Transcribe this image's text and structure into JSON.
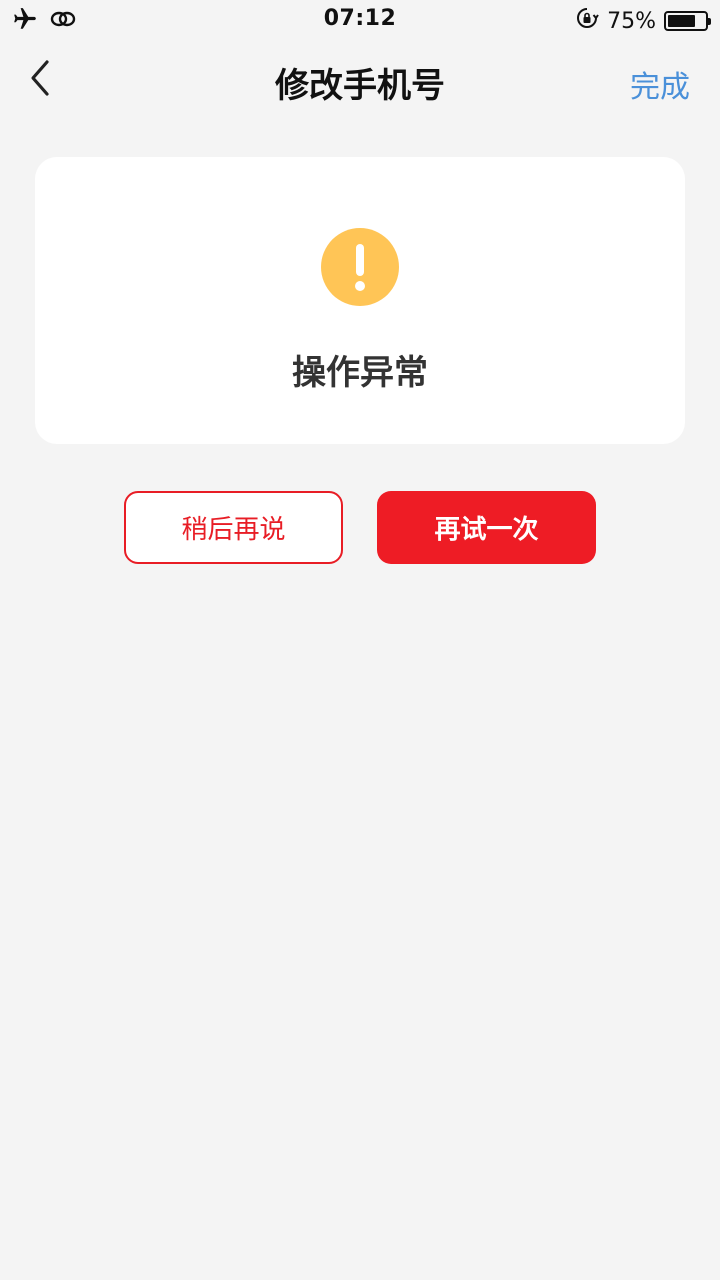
{
  "status_bar": {
    "time": "07:12",
    "battery_percent": "75%",
    "battery_level": 0.75,
    "icons": [
      "airplane-icon",
      "link-icon",
      "rotation-lock-icon",
      "battery-icon"
    ]
  },
  "navbar": {
    "title": "修改手机号",
    "done_label": "完成",
    "done_color": "#4a90d9"
  },
  "card": {
    "icon": "warning-icon",
    "icon_color": "#ffc556",
    "message": "操作异常"
  },
  "actions": {
    "later_label": "稍后再说",
    "retry_label": "再试一次",
    "accent_color": "#ee1c25"
  }
}
